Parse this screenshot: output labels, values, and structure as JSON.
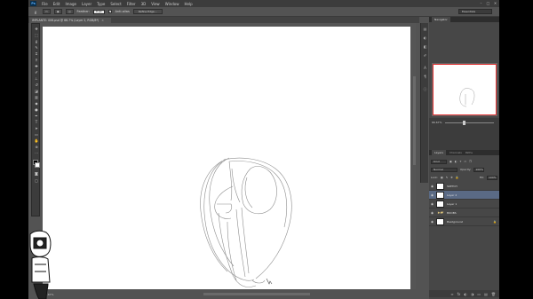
{
  "menubar": {
    "logo": "Ps",
    "items": [
      "File",
      "Edit",
      "Image",
      "Layer",
      "Type",
      "Select",
      "Filter",
      "3D",
      "View",
      "Window",
      "Help"
    ],
    "window_buttons": [
      "–",
      "□",
      "✕"
    ]
  },
  "options": {
    "feather_label": "Feather:",
    "feather_value": "0 px",
    "antialias_label": "Anti-alias",
    "refine_button": "Refine Edge...",
    "workspace": "Essentials"
  },
  "document": {
    "tab_title": "IMPLANTE: 006.psd @ 66.7% (Layer 2, RGB/8*)",
    "tab_close": "×"
  },
  "status": {
    "zoom": "66.67%"
  },
  "navigator": {
    "tab_active": "Navigator",
    "zoom": "66.67%"
  },
  "layers": {
    "tabs": [
      "Layers",
      "Channels",
      "Paths"
    ],
    "kind": "Kind",
    "blend_mode": "Normal",
    "opacity_label": "Opacity:",
    "opacity": "100%",
    "lock_label": "Lock:",
    "fill_label": "Fill:",
    "fill": "100%",
    "rows": [
      {
        "name": "SKETCH",
        "selected": false,
        "type": "layer"
      },
      {
        "name": "Layer 2",
        "selected": true,
        "type": "layer"
      },
      {
        "name": "Layer 1",
        "selected": false,
        "type": "layer"
      },
      {
        "name": "BOOBS",
        "selected": false,
        "type": "group"
      },
      {
        "name": "Background",
        "selected": false,
        "type": "layer",
        "locked": true
      }
    ],
    "footer_icons": [
      "∞",
      "fx",
      "◐",
      "◑",
      "▭",
      "▤",
      "🗑"
    ]
  },
  "colors": {
    "ui_bg": "#535353",
    "panel_bg": "#474747",
    "selection": "#5a6a85",
    "nav_frame": "#e03030"
  }
}
